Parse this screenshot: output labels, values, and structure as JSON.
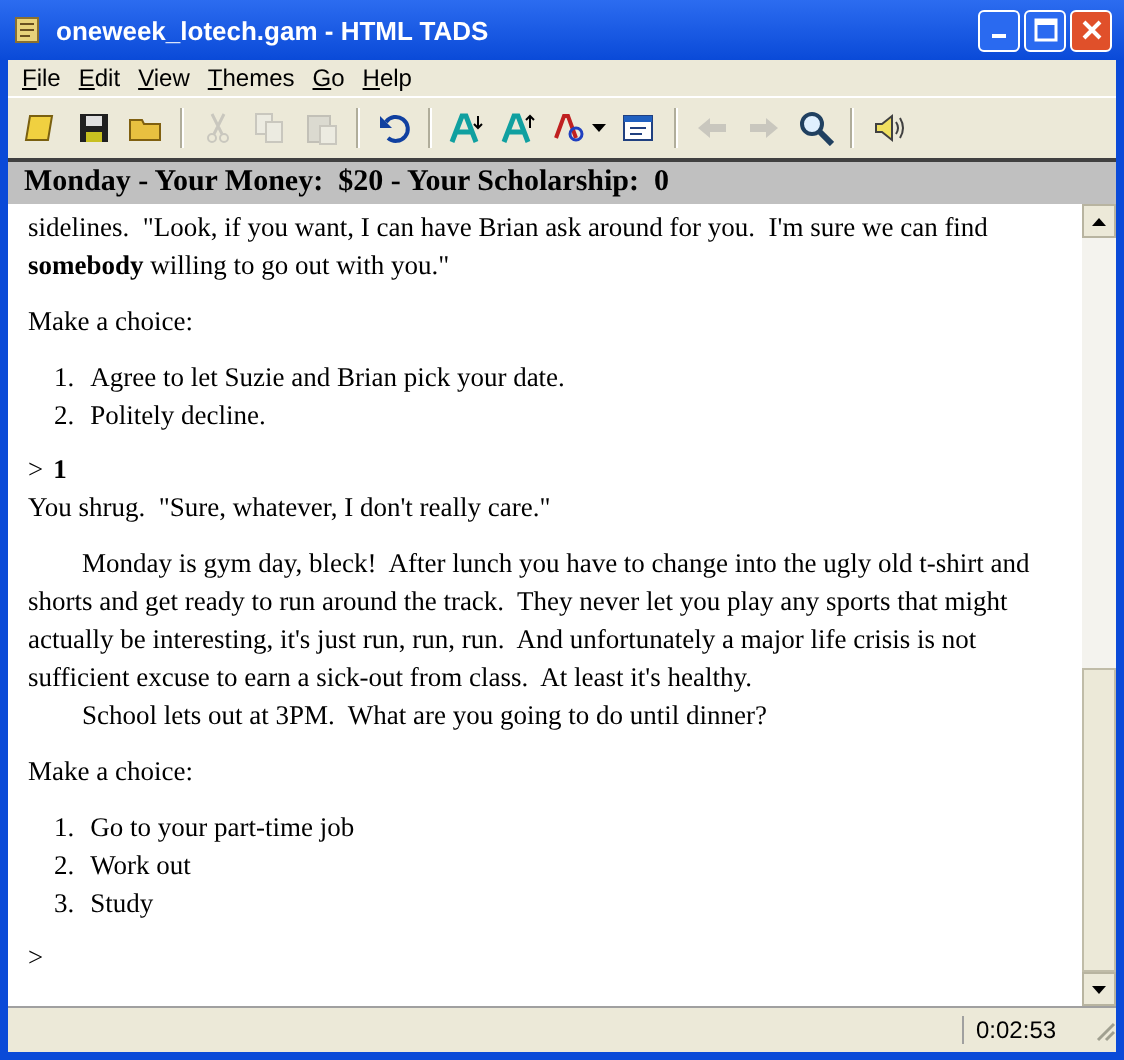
{
  "window": {
    "title": "oneweek_lotech.gam - HTML TADS"
  },
  "menu": [
    {
      "label": "File"
    },
    {
      "label": "Edit"
    },
    {
      "label": "View"
    },
    {
      "label": "Themes"
    },
    {
      "label": "Go"
    },
    {
      "label": "Help"
    }
  ],
  "toolbar": [
    {
      "kind": "button",
      "disabled": false
    },
    {
      "kind": "button",
      "disabled": false
    },
    {
      "kind": "button",
      "disabled": false
    },
    {
      "kind": "separator"
    },
    {
      "kind": "button",
      "disabled": true
    },
    {
      "kind": "button",
      "disabled": true
    },
    {
      "kind": "button",
      "disabled": true
    },
    {
      "kind": "separator"
    },
    {
      "kind": "button",
      "disabled": false
    },
    {
      "kind": "separator"
    },
    {
      "kind": "button",
      "disabled": false
    },
    {
      "kind": "button",
      "disabled": false
    },
    {
      "kind": "dropdown",
      "disabled": false
    },
    {
      "kind": "button",
      "disabled": false
    },
    {
      "kind": "separator"
    },
    {
      "kind": "button",
      "disabled": true
    },
    {
      "kind": "button",
      "disabled": true
    },
    {
      "kind": "button",
      "disabled": false
    },
    {
      "kind": "separator"
    },
    {
      "kind": "button",
      "disabled": false
    }
  ],
  "status_line": "Monday - Your Money:  $20 - Your Scholarship:  0",
  "transcript": [
    {
      "kind": "prose",
      "indent": false,
      "paragraphs": [
        "sidelines.  \"Look, if you want, I can have Brian ask around for you.  I'm sure we can find **somebody** willing to go out with you.\""
      ]
    },
    {
      "kind": "prose",
      "indent": false,
      "paragraphs": [
        "Make a choice:"
      ]
    },
    {
      "kind": "choices",
      "items": [
        {
          "number": "1.",
          "text": "Agree to let Suzie and Brian pick your date."
        },
        {
          "number": "2.",
          "text": "Politely decline."
        }
      ]
    },
    {
      "kind": "command",
      "prompt": ">",
      "input": "1"
    },
    {
      "kind": "prose",
      "indent": false,
      "paragraphs": [
        "You shrug.  \"Sure, whatever, I don't really care.\""
      ]
    },
    {
      "kind": "prose",
      "indent": true,
      "paragraphs": [
        "Monday is gym day, bleck!  After lunch you have to change into the ugly old t-shirt and shorts and get ready to run around the track.  They never let you play any sports that might actually be interesting, it's just run, run, run.  And unfortunately a major life crisis is not sufficient excuse to earn a sick-out from class.  At least it's healthy.",
        "School lets out at 3PM.  What are you going to do until dinner?"
      ]
    },
    {
      "kind": "prose",
      "indent": false,
      "paragraphs": [
        "Make a choice:"
      ]
    },
    {
      "kind": "choices",
      "items": [
        {
          "number": "1.",
          "text": "Go to your part-time job"
        },
        {
          "number": "2.",
          "text": "Work out"
        },
        {
          "number": "3.",
          "text": "Study"
        }
      ]
    },
    {
      "kind": "command",
      "prompt": ">"
    }
  ],
  "status_bar": {
    "elapsed": "0:02:53"
  }
}
